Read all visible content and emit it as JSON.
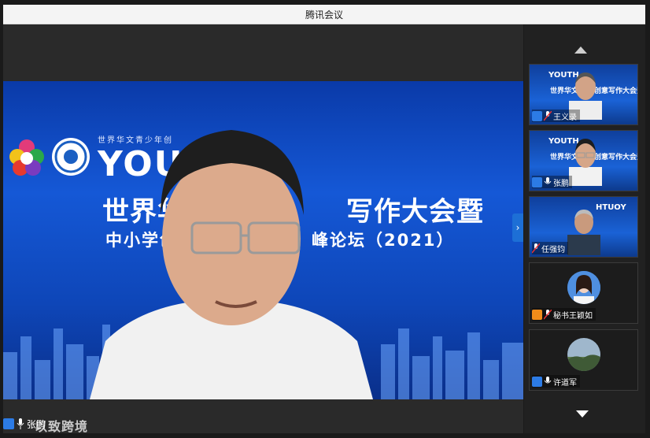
{
  "window": {
    "title": "腾讯会议"
  },
  "main_video": {
    "banner_top": "世界华文青少年创",
    "banner_youth": "YOUTH",
    "headline_left": "世界华文",
    "headline_right": "写作大会暨",
    "subline_left": "中小学创",
    "subline_right": "峰论坛（2021）",
    "speaker_name": "张鹏",
    "watermark": "以致跨境"
  },
  "participants": [
    {
      "name": "王义录",
      "badge_color": "#2c7be5",
      "type": "video",
      "bg_text": "世界华文",
      "bg_text2": "创意写作大会暨",
      "youth": "YOUTH"
    },
    {
      "name": "张鹏",
      "badge_color": "#2c7be5",
      "type": "video",
      "bg_text": "世界华文",
      "bg_text2": "创意写作大会暨",
      "youth": "YOUTH"
    },
    {
      "name": "任强钧",
      "badge_color": "",
      "type": "video",
      "bg_text": "",
      "bg_text2": "",
      "youth": "HTUOY"
    },
    {
      "name": "秘书王颖如",
      "badge_color": "#f08c1a",
      "type": "avatar"
    },
    {
      "name": "许道军",
      "badge_color": "#2c7be5",
      "type": "avatar"
    }
  ]
}
